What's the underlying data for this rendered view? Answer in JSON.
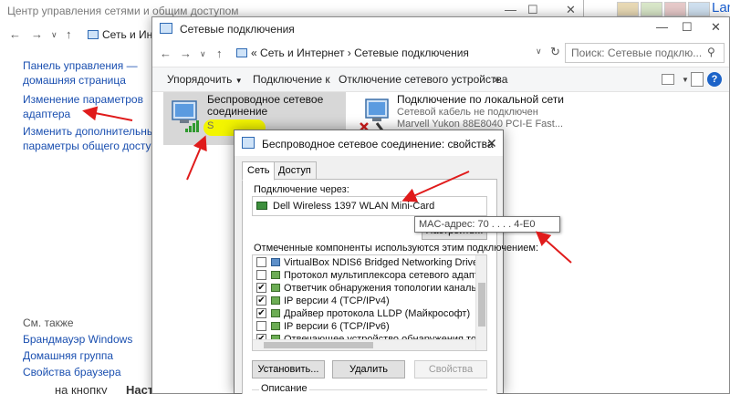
{
  "background_window": {
    "title": "Центр управления сетями и общим доступом",
    "breadcrumb": "Сеть и Интерн",
    "sidebar": {
      "home_line1": "Панель управления —",
      "home_line2": "домашняя страница",
      "adapter_line1": "Изменение параметров",
      "adapter_line2": "адаптера",
      "sharing_line1": "Изменить дополнительные",
      "sharing_line2": "параметры общего доступа"
    },
    "see_also": {
      "heading": "См. также",
      "items": [
        "Брандмауэр Windows",
        "Домашняя группа",
        "Свойства браузера"
      ]
    },
    "bottom_text_a": "на кнопку",
    "bottom_text_b": "Наст"
  },
  "browser": {
    "landing_text": "Landing"
  },
  "network_connections": {
    "title": "Сетевые подключения",
    "breadcrumb_root": "«",
    "breadcrumb_parent": "Сеть и Интернет",
    "breadcrumb_sep": "›",
    "breadcrumb_current": "Сетевые подключения",
    "search_placeholder": "Поиск: Сетевые подклю...",
    "toolbar": {
      "organize": "Упорядочить",
      "connect_to": "Подключение к",
      "disable_device": "Отключение сетевого устройства",
      "more": "»",
      "help": "?"
    },
    "connections": [
      {
        "name_line1": "Беспроводное сетевое",
        "name_line2": "соединение",
        "status": "S"
      },
      {
        "name": "Подключение по локальной сети",
        "status": "Сетевой кабель не подключен",
        "device": "Marvell Yukon 88E8040 PCI-E Fast..."
      }
    ]
  },
  "properties_dialog": {
    "title": "Беспроводное сетевое соединение: свойства",
    "tabs": [
      "Сеть",
      "Доступ"
    ],
    "connect_using_label": "Подключение через:",
    "adapter_name": "Dell Wireless 1397 WLAN Mini-Card",
    "configure_button": "Настроить...",
    "mac_tooltip": "MAC-адрес: 70 . . . . 4-E0",
    "components_label": "Отмеченные компоненты используются этим подключением:",
    "components": [
      {
        "label": "VirtualBox NDIS6 Bridged Networking Driver",
        "checked": false
      },
      {
        "label": "Протокол мультиплексора сетевого адаптера (Ма",
        "checked": false
      },
      {
        "label": "Ответчик обнаружения топологии канального уров",
        "checked": true
      },
      {
        "label": "IP версии 4 (TCP/IPv4)",
        "checked": true
      },
      {
        "label": "Драйвер протокола LLDP (Майкрософт)",
        "checked": true
      },
      {
        "label": "IP версии 6 (TCP/IPv6)",
        "checked": false
      },
      {
        "label": "Отвечающее устройство обнаружения топологии к",
        "checked": true
      }
    ],
    "install_button": "Установить...",
    "remove_button": "Удалить",
    "properties_button": "Свойства",
    "description_label": "Описание"
  },
  "colors": {
    "link": "#1a4fb0",
    "highlight": "#f3f500",
    "arrow": "#e01b1b",
    "help": "#1c63c8"
  }
}
